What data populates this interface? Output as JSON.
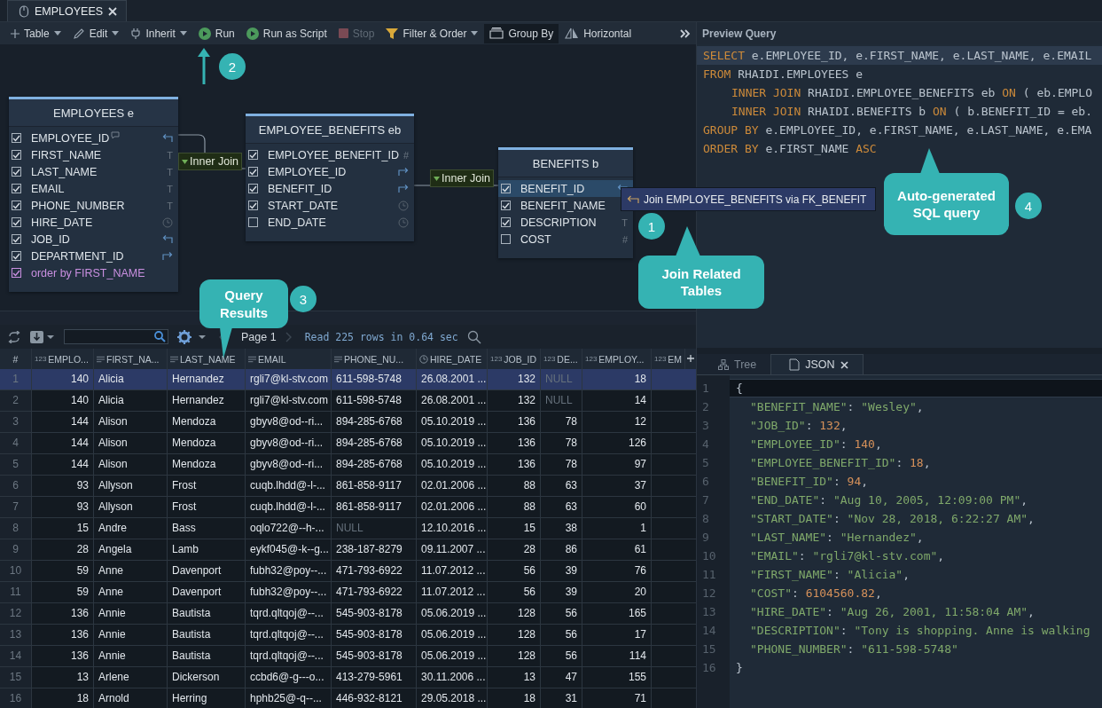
{
  "editor_tab": {
    "title": "EMPLOYEES"
  },
  "toolbar": [
    {
      "label": "Table",
      "dropdown": true,
      "disabled": false,
      "selected": false
    },
    {
      "label": "Edit",
      "dropdown": true,
      "disabled": false,
      "selected": false
    },
    {
      "label": "Inherit",
      "dropdown": true,
      "disabled": false,
      "selected": false
    },
    {
      "label": "Run",
      "dropdown": false,
      "disabled": false,
      "selected": false
    },
    {
      "label": "Run as Script",
      "dropdown": false,
      "disabled": false,
      "selected": false
    },
    {
      "label": "Stop",
      "dropdown": false,
      "disabled": true,
      "selected": false
    },
    {
      "label": "Filter & Order",
      "dropdown": true,
      "disabled": false,
      "selected": false
    },
    {
      "label": "Group By",
      "dropdown": false,
      "disabled": false,
      "selected": true
    },
    {
      "label": "Horizontal",
      "dropdown": false,
      "disabled": false,
      "selected": false
    }
  ],
  "diagram": {
    "tables": [
      {
        "title": "EMPLOYEES e",
        "columns": [
          {
            "name": "EMPLOYEE_ID",
            "kind": "ref_in",
            "checked": true,
            "selected": false,
            "comment": true
          },
          {
            "name": "FIRST_NAME",
            "kind": "text",
            "checked": true,
            "selected": false,
            "comment": false,
            "type_label": "T"
          },
          {
            "name": "LAST_NAME",
            "kind": "text",
            "checked": true,
            "selected": false,
            "comment": false,
            "type_label": "T"
          },
          {
            "name": "EMAIL",
            "kind": "text",
            "checked": true,
            "selected": false,
            "comment": false,
            "type_label": "T"
          },
          {
            "name": "PHONE_NUMBER",
            "kind": "text",
            "checked": true,
            "selected": false,
            "comment": false,
            "type_label": "T"
          },
          {
            "name": "HIRE_DATE",
            "kind": "date",
            "checked": true,
            "selected": false,
            "comment": false
          },
          {
            "name": "JOB_ID",
            "kind": "ref_in",
            "checked": true,
            "selected": false,
            "comment": false
          },
          {
            "name": "DEPARTMENT_ID",
            "kind": "ref_out",
            "checked": true,
            "selected": false,
            "comment": false
          },
          {
            "name": "order by FIRST_NAME",
            "kind": "order",
            "checked": true,
            "selected": false,
            "comment": false
          }
        ]
      },
      {
        "title": "EMPLOYEE_BENEFITS eb",
        "columns": [
          {
            "name": "EMPLOYEE_BENEFIT_ID",
            "kind": "number",
            "checked": true,
            "selected": false,
            "type_label": "#"
          },
          {
            "name": "EMPLOYEE_ID",
            "kind": "ref_out",
            "checked": true,
            "selected": false
          },
          {
            "name": "BENEFIT_ID",
            "kind": "ref_out",
            "checked": true,
            "selected": false
          },
          {
            "name": "START_DATE",
            "kind": "date",
            "checked": true,
            "selected": false
          },
          {
            "name": "END_DATE",
            "kind": "date",
            "checked": false,
            "selected": false
          }
        ]
      },
      {
        "title": "BENEFITS b",
        "columns": [
          {
            "name": "BENEFIT_ID",
            "kind": "ref_in",
            "checked": true,
            "selected": true
          },
          {
            "name": "BENEFIT_NAME",
            "kind": "text",
            "checked": true,
            "selected": false
          },
          {
            "name": "DESCRIPTION",
            "kind": "text",
            "checked": true,
            "selected": false,
            "type_label": "T"
          },
          {
            "name": "COST",
            "kind": "number",
            "checked": false,
            "selected": false,
            "type_label": "#"
          }
        ]
      }
    ],
    "joins": [
      {
        "label": "Inner Join"
      },
      {
        "label": "Inner Join"
      }
    ],
    "popup": {
      "label": "Join EMPLOYEE_BENEFITS via FK_BENEFIT"
    }
  },
  "callouts": [
    {
      "kind": "arrow",
      "number": "2"
    },
    {
      "kind": "bubble",
      "number": "1",
      "text": "Join Related Tables"
    },
    {
      "kind": "bubble",
      "number": "3",
      "text": "Query Results"
    },
    {
      "kind": "bubble",
      "number": "4",
      "text": "Auto-generated SQL query"
    }
  ],
  "results_toolbar": {
    "page": "Page 1",
    "status": "Read 225 rows in 0.64 sec"
  },
  "results": {
    "columns": [
      {
        "label": "#",
        "kind": "index"
      },
      {
        "label": "EMPLO...",
        "kind": "number",
        "type_label": "123"
      },
      {
        "label": "FIRST_NA...",
        "kind": "text"
      },
      {
        "label": "LAST_NAME",
        "kind": "text"
      },
      {
        "label": "EMAIL",
        "kind": "text"
      },
      {
        "label": "PHONE_NU...",
        "kind": "text"
      },
      {
        "label": "HIRE_DATE",
        "kind": "date"
      },
      {
        "label": "JOB_ID",
        "kind": "number",
        "type_label": "123"
      },
      {
        "label": "DE...",
        "kind": "number",
        "type_label": "123"
      },
      {
        "label": "EMPLOY...",
        "kind": "number",
        "type_label": "123"
      },
      {
        "label": "EM",
        "kind": "number",
        "type_label": "123"
      }
    ],
    "rows": [
      {
        "selected": true,
        "cells": [
          "1",
          "140",
          "Alicia",
          "Hernandez",
          "rgli7@kl-stv.com",
          "611-598-5748",
          "26.08.2001 ...",
          "132",
          {
            "text": "NULL",
            "null": true
          },
          "18"
        ]
      },
      {
        "selected": false,
        "cells": [
          "2",
          "140",
          "Alicia",
          "Hernandez",
          "rgli7@kl-stv.com",
          "611-598-5748",
          "26.08.2001 ...",
          "132",
          {
            "text": "NULL",
            "null": true
          },
          "14"
        ]
      },
      {
        "selected": false,
        "cells": [
          "3",
          "144",
          "Alison",
          "Mendoza",
          "gbyv8@od--ri...",
          "894-285-6768",
          "05.10.2019 ...",
          "136",
          "78",
          "12"
        ]
      },
      {
        "selected": false,
        "cells": [
          "4",
          "144",
          "Alison",
          "Mendoza",
          "gbyv8@od--ri...",
          "894-285-6768",
          "05.10.2019 ...",
          "136",
          "78",
          "126"
        ]
      },
      {
        "selected": false,
        "cells": [
          "5",
          "144",
          "Alison",
          "Mendoza",
          "gbyv8@od--ri...",
          "894-285-6768",
          "05.10.2019 ...",
          "136",
          "78",
          "97"
        ]
      },
      {
        "selected": false,
        "cells": [
          "6",
          "93",
          "Allyson",
          "Frost",
          "cuqb.lhdd@-l-...",
          "861-858-9117",
          "02.01.2006 ...",
          "88",
          "63",
          "37"
        ]
      },
      {
        "selected": false,
        "cells": [
          "7",
          "93",
          "Allyson",
          "Frost",
          "cuqb.lhdd@-l-...",
          "861-858-9117",
          "02.01.2006 ...",
          "88",
          "63",
          "60"
        ]
      },
      {
        "selected": false,
        "cells": [
          "8",
          "15",
          "Andre",
          "Bass",
          "oqlo722@--h-...",
          {
            "text": "NULL",
            "null": true
          },
          "12.10.2016 ...",
          "15",
          "38",
          "1"
        ]
      },
      {
        "selected": false,
        "cells": [
          "9",
          "28",
          "Angela",
          "Lamb",
          "eykf045@-k--g...",
          "238-187-8279",
          "09.11.2007 ...",
          "28",
          "86",
          "61"
        ]
      },
      {
        "selected": false,
        "cells": [
          "10",
          "59",
          "Anne",
          "Davenport",
          "fubh32@poy--...",
          "471-793-6922",
          "11.07.2012 ...",
          "56",
          "39",
          "76"
        ]
      },
      {
        "selected": false,
        "cells": [
          "11",
          "59",
          "Anne",
          "Davenport",
          "fubh32@poy--...",
          "471-793-6922",
          "11.07.2012 ...",
          "56",
          "39",
          "20"
        ]
      },
      {
        "selected": false,
        "cells": [
          "12",
          "136",
          "Annie",
          "Bautista",
          "tqrd.qltqoj@--...",
          "545-903-8178",
          "05.06.2019 ...",
          "128",
          "56",
          "165"
        ]
      },
      {
        "selected": false,
        "cells": [
          "13",
          "136",
          "Annie",
          "Bautista",
          "tqrd.qltqoj@--...",
          "545-903-8178",
          "05.06.2019 ...",
          "128",
          "56",
          "17"
        ]
      },
      {
        "selected": false,
        "cells": [
          "14",
          "136",
          "Annie",
          "Bautista",
          "tqrd.qltqoj@--...",
          "545-903-8178",
          "05.06.2019 ...",
          "128",
          "56",
          "114"
        ]
      },
      {
        "selected": false,
        "cells": [
          "15",
          "13",
          "Arlene",
          "Dickerson",
          "ccbd6@-g---o...",
          "413-279-5961",
          "30.11.2006 ...",
          "13",
          "47",
          "155"
        ]
      },
      {
        "selected": false,
        "cells": [
          "16",
          "18",
          "Arnold",
          "Herring",
          "hphb25@-q--...",
          "446-932-8121",
          "29.05.2018 ...",
          "18",
          "31",
          "71"
        ]
      }
    ]
  },
  "preview": {
    "title": "Preview Query",
    "lines": [
      {
        "current": true,
        "indented": false,
        "parts": [
          {
            "text": "SELECT",
            "keyword": true
          },
          {
            "text": " e.EMPLOYEE_ID, e.FIRST_NAME, e.LAST_NAME, e.EMAIL",
            "keyword": false
          }
        ]
      },
      {
        "current": false,
        "indented": false,
        "parts": [
          {
            "text": "FROM",
            "keyword": true
          },
          {
            "text": " RHAIDI.EMPLOYEES e",
            "keyword": false
          }
        ]
      },
      {
        "current": false,
        "indented": true,
        "parts": [
          {
            "text": "INNER JOIN",
            "keyword": true
          },
          {
            "text": " RHAIDI.EMPLOYEE_BENEFITS eb ",
            "keyword": false
          },
          {
            "text": "ON",
            "keyword": true
          },
          {
            "text": " ( eb.EMPLO",
            "keyword": false
          }
        ]
      },
      {
        "current": false,
        "indented": true,
        "parts": [
          {
            "text": "INNER JOIN",
            "keyword": true
          },
          {
            "text": " RHAIDI.BENEFITS b ",
            "keyword": false
          },
          {
            "text": "ON",
            "keyword": true
          },
          {
            "text": " ( b.BENEFIT_ID = eb.",
            "keyword": false
          }
        ]
      },
      {
        "current": false,
        "indented": false,
        "parts": [
          {
            "text": "GROUP BY",
            "keyword": true
          },
          {
            "text": " e.EMPLOYEE_ID, e.FIRST_NAME, e.LAST_NAME, e.EMA",
            "keyword": false
          }
        ]
      },
      {
        "current": false,
        "indented": false,
        "parts": [
          {
            "text": "ORDER BY",
            "keyword": true
          },
          {
            "text": " e.FIRST_NAME ",
            "keyword": false
          },
          {
            "text": "ASC",
            "keyword": true
          }
        ]
      }
    ]
  },
  "viewer": {
    "tabs": [
      {
        "label": "Tree",
        "selected": false,
        "closable": false
      },
      {
        "label": "JSON",
        "selected": true,
        "closable": true
      }
    ],
    "lines": [
      {
        "number": "1",
        "current": true,
        "indented": false,
        "parts": [
          {
            "text": "{",
            "kind": "punct"
          }
        ]
      },
      {
        "number": "2",
        "current": false,
        "indented": true,
        "parts": [
          {
            "text": "\"BENEFIT_NAME\"",
            "kind": "key"
          },
          {
            "text": ": ",
            "kind": "punct"
          },
          {
            "text": "\"Wesley\"",
            "kind": "string"
          },
          {
            "text": ",",
            "kind": "punct"
          }
        ]
      },
      {
        "number": "3",
        "current": false,
        "indented": true,
        "parts": [
          {
            "text": "\"JOB_ID\"",
            "kind": "key"
          },
          {
            "text": ": ",
            "kind": "punct"
          },
          {
            "text": "132",
            "kind": "number"
          },
          {
            "text": ",",
            "kind": "punct"
          }
        ]
      },
      {
        "number": "4",
        "current": false,
        "indented": true,
        "parts": [
          {
            "text": "\"EMPLOYEE_ID\"",
            "kind": "key"
          },
          {
            "text": ": ",
            "kind": "punct"
          },
          {
            "text": "140",
            "kind": "number"
          },
          {
            "text": ",",
            "kind": "punct"
          }
        ]
      },
      {
        "number": "5",
        "current": false,
        "indented": true,
        "parts": [
          {
            "text": "\"EMPLOYEE_BENEFIT_ID\"",
            "kind": "key"
          },
          {
            "text": ": ",
            "kind": "punct"
          },
          {
            "text": "18",
            "kind": "number"
          },
          {
            "text": ",",
            "kind": "punct"
          }
        ]
      },
      {
        "number": "6",
        "current": false,
        "indented": true,
        "parts": [
          {
            "text": "\"BENEFIT_ID\"",
            "kind": "key"
          },
          {
            "text": ": ",
            "kind": "punct"
          },
          {
            "text": "94",
            "kind": "number"
          },
          {
            "text": ",",
            "kind": "punct"
          }
        ]
      },
      {
        "number": "7",
        "current": false,
        "indented": true,
        "parts": [
          {
            "text": "\"END_DATE\"",
            "kind": "key"
          },
          {
            "text": ": ",
            "kind": "punct"
          },
          {
            "text": "\"Aug 10, 2005, 12:09:00 PM\"",
            "kind": "string"
          },
          {
            "text": ",",
            "kind": "punct"
          }
        ]
      },
      {
        "number": "8",
        "current": false,
        "indented": true,
        "parts": [
          {
            "text": "\"START_DATE\"",
            "kind": "key"
          },
          {
            "text": ": ",
            "kind": "punct"
          },
          {
            "text": "\"Nov 28, 2018, 6:22:27 AM\"",
            "kind": "string"
          },
          {
            "text": ",",
            "kind": "punct"
          }
        ]
      },
      {
        "number": "9",
        "current": false,
        "indented": true,
        "parts": [
          {
            "text": "\"LAST_NAME\"",
            "kind": "key"
          },
          {
            "text": ": ",
            "kind": "punct"
          },
          {
            "text": "\"Hernandez\"",
            "kind": "string"
          },
          {
            "text": ",",
            "kind": "punct"
          }
        ]
      },
      {
        "number": "10",
        "current": false,
        "indented": true,
        "parts": [
          {
            "text": "\"EMAIL\"",
            "kind": "key"
          },
          {
            "text": ": ",
            "kind": "punct"
          },
          {
            "text": "\"rgli7@kl-stv.com\"",
            "kind": "string"
          },
          {
            "text": ",",
            "kind": "punct"
          }
        ]
      },
      {
        "number": "11",
        "current": false,
        "indented": true,
        "parts": [
          {
            "text": "\"FIRST_NAME\"",
            "kind": "key"
          },
          {
            "text": ": ",
            "kind": "punct"
          },
          {
            "text": "\"Alicia\"",
            "kind": "string"
          },
          {
            "text": ",",
            "kind": "punct"
          }
        ]
      },
      {
        "number": "12",
        "current": false,
        "indented": true,
        "parts": [
          {
            "text": "\"COST\"",
            "kind": "key"
          },
          {
            "text": ": ",
            "kind": "punct"
          },
          {
            "text": "6104560.82",
            "kind": "number"
          },
          {
            "text": ",",
            "kind": "punct"
          }
        ]
      },
      {
        "number": "13",
        "current": false,
        "indented": true,
        "parts": [
          {
            "text": "\"HIRE_DATE\"",
            "kind": "key"
          },
          {
            "text": ": ",
            "kind": "punct"
          },
          {
            "text": "\"Aug 26, 2001, 11:58:04 AM\"",
            "kind": "string"
          },
          {
            "text": ",",
            "kind": "punct"
          }
        ]
      },
      {
        "number": "14",
        "current": false,
        "indented": true,
        "parts": [
          {
            "text": "\"DESCRIPTION\"",
            "kind": "key"
          },
          {
            "text": ": ",
            "kind": "punct"
          },
          {
            "text": "\"Tony is shopping. Anne is walking",
            "kind": "string"
          }
        ]
      },
      {
        "number": "15",
        "current": false,
        "indented": true,
        "parts": [
          {
            "text": "\"PHONE_NUMBER\"",
            "kind": "key"
          },
          {
            "text": ": ",
            "kind": "punct"
          },
          {
            "text": "\"611-598-5748\"",
            "kind": "string"
          }
        ]
      },
      {
        "number": "16",
        "current": false,
        "indented": false,
        "parts": [
          {
            "text": "}",
            "kind": "punct"
          }
        ]
      }
    ]
  }
}
